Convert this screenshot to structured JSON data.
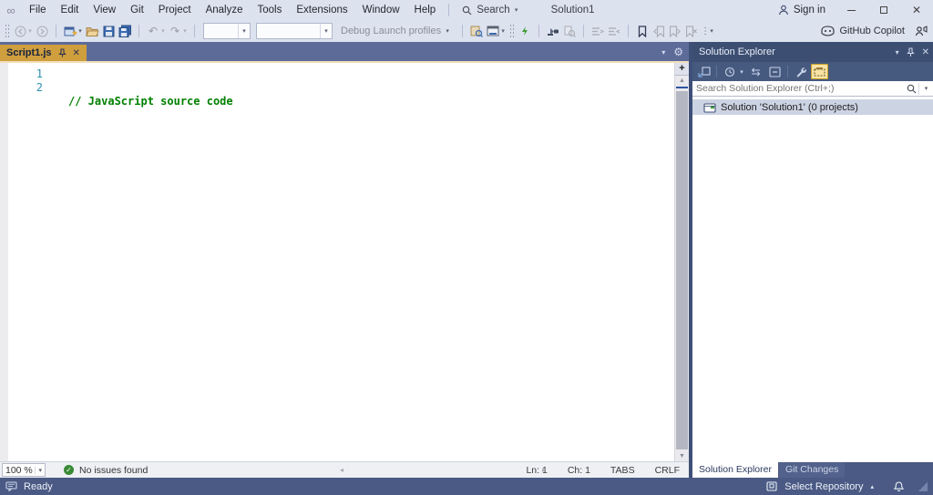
{
  "titlebar": {
    "menus": [
      "File",
      "Edit",
      "View",
      "Git",
      "Project",
      "Analyze",
      "Tools",
      "Extensions",
      "Window",
      "Help"
    ],
    "search_label": "Search",
    "solution_name": "Solution1",
    "sign_in_label": "Sign in"
  },
  "toolbar": {
    "debug_profiles_label": "Debug Launch profiles",
    "copilot_label": "GitHub Copilot"
  },
  "editor": {
    "tab_title": "Script1.js",
    "lines": [
      {
        "n": "1",
        "code": "// JavaScript source code"
      },
      {
        "n": "2",
        "code": ""
      }
    ],
    "bottom": {
      "zoom": "100 %",
      "issues": "No issues found",
      "ln": "Ln: 1",
      "ch": "Ch: 1",
      "tabs": "TABS",
      "eol": "CRLF"
    }
  },
  "solution_explorer": {
    "title": "Solution Explorer",
    "search_placeholder": "Search Solution Explorer (Ctrl+;)",
    "tree_root": "Solution 'Solution1' (0 projects)",
    "tab_solution_explorer": "Solution Explorer",
    "tab_git_changes": "Git Changes"
  },
  "statusbar": {
    "ready": "Ready",
    "select_repository": "Select Repository"
  },
  "colors": {
    "active_tab_gold": "#cf9e3d",
    "comment_green": "#008000",
    "line_number_blue": "#2b91af",
    "chrome_dark": "#4a5a84",
    "chrome_light": "#dde2ef"
  }
}
